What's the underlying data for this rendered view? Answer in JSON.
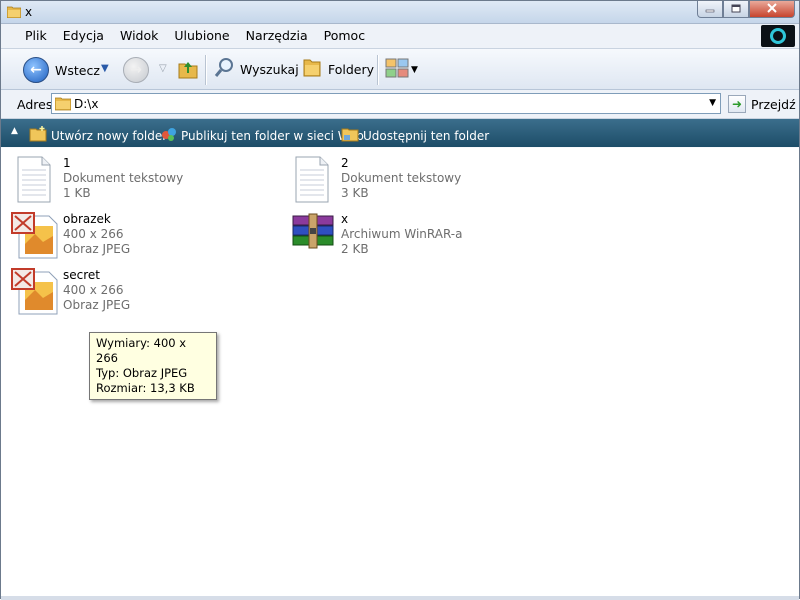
{
  "window": {
    "title": "x"
  },
  "menu": {
    "items": [
      "Plik",
      "Edycja",
      "Widok",
      "Ulubione",
      "Narzędzia",
      "Pomoc"
    ]
  },
  "toolbar": {
    "back_label": "Wstecz",
    "search_label": "Wyszukaj",
    "folders_label": "Foldery"
  },
  "address": {
    "label": "Adres",
    "value": "D:\\x",
    "go_label": "Przejdź"
  },
  "tasks": {
    "new_folder": "Utwórz nowy folder",
    "publish": "Publikuj ten folder w sieci Web",
    "share": "Udostępnij ten folder"
  },
  "files": [
    {
      "name": "1",
      "type": "Dokument tekstowy",
      "size": "1 KB",
      "icon": "text-file-icon"
    },
    {
      "name": "2",
      "type": "Dokument tekstowy",
      "size": "3 KB",
      "icon": "text-file-icon"
    },
    {
      "name": "obrazek",
      "dimensions": "400 x 266",
      "type": "Obraz JPEG",
      "icon": "jpeg-file-icon"
    },
    {
      "name": "x",
      "type": "Archiwum WinRAR-a",
      "size": "2 KB",
      "icon": "winrar-archive-icon"
    },
    {
      "name": "secret",
      "dimensions": "400 x 266",
      "type": "Obraz JPEG",
      "icon": "jpeg-file-icon"
    }
  ],
  "tooltip": {
    "line1": "Wymiary: 400 x 266",
    "line2": "Typ: Obraz JPEG",
    "line3": "Rozmiar: 13,3 KB"
  },
  "colors": {
    "taskbar": "#1d4d68",
    "tooltip_bg": "#ffffe1",
    "meta_text": "#6d6d6d"
  }
}
